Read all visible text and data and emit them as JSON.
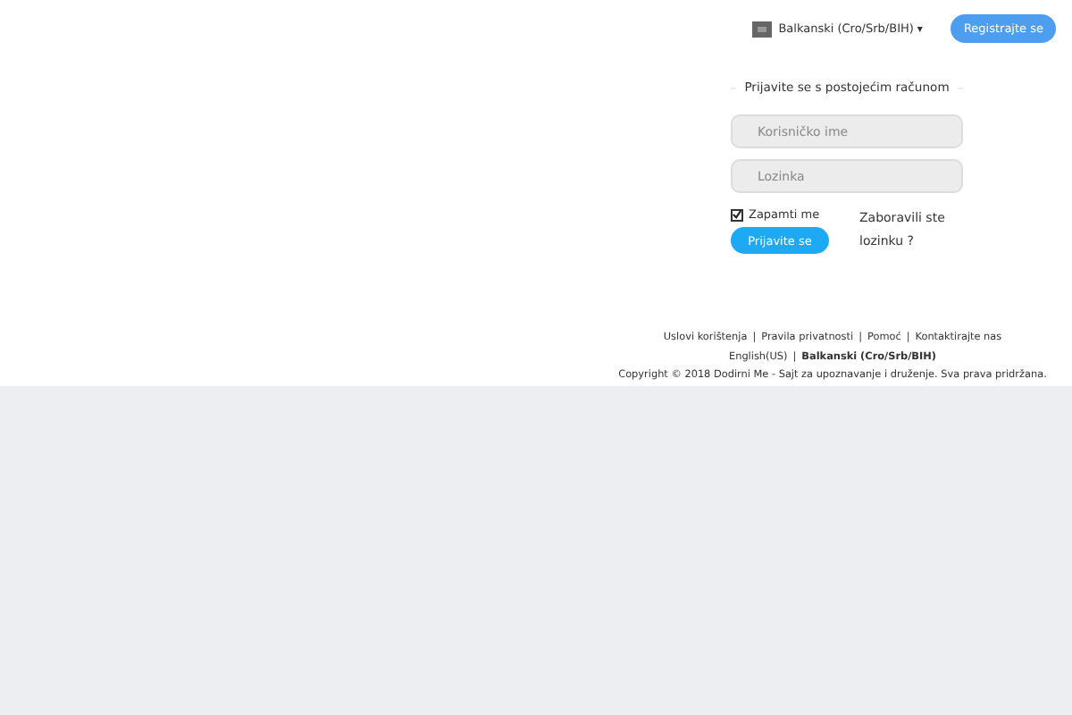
{
  "header": {
    "language": "Balkanski (Cro/Srb/BIH)",
    "caret": "▾",
    "register_button": "Registrajte se"
  },
  "login": {
    "title": "Prijavite se s postojećim računom",
    "username": {
      "placeholder": "Korisničko ime"
    },
    "password": {
      "placeholder": "Lozinka"
    },
    "remember": {
      "label": "Zapamti me",
      "checked": true
    },
    "submit": "Prijavite se",
    "forgot": "Zaboravili ste lozinku ?"
  },
  "footer": {
    "separator": "|",
    "links": [
      "Uslovi korištenja",
      "Pravila privatnosti",
      "Pomoć",
      "Kontaktirajte nas"
    ],
    "languages": [
      {
        "label": "English(US)",
        "selected": false
      },
      {
        "label": "Balkanski (Cro/Srb/BIH)",
        "selected": true
      }
    ],
    "copyright": "Copyright © 2018 Dodirni Me - Sajt za upoznavanje i druženje. Sva prava pridržana."
  }
}
